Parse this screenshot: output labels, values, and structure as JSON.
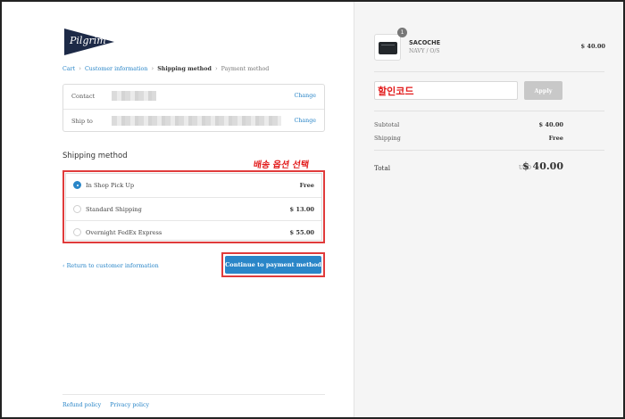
{
  "brand": {
    "logo_text": "Pilgrim",
    "logo_color": "#1d2a47"
  },
  "breadcrumb": {
    "cart": "Cart",
    "customer_information": "Customer information",
    "shipping_method": "Shipping method",
    "payment_method": "Payment method"
  },
  "review": {
    "contact_label": "Contact",
    "ship_to_label": "Ship to",
    "change_label": "Change"
  },
  "shipping": {
    "title": "Shipping method",
    "annotation": "배송 옵션 선택",
    "options": [
      {
        "label": "In Shop Pick Up",
        "price": "Free",
        "selected": true
      },
      {
        "label": "Standard Shipping",
        "price": "$ 13.00",
        "selected": false
      },
      {
        "label": "Overnight FedEx Express",
        "price": "$ 55.00",
        "selected": false
      }
    ]
  },
  "actions": {
    "return_label": "Return to customer information",
    "continue_label": "Continue to payment method"
  },
  "footer": {
    "refund": "Refund policy",
    "privacy": "Privacy policy"
  },
  "order": {
    "quantity": "1",
    "product_name": "SACOCHE",
    "variant": "NAVY / O/S",
    "product_price": "$ 40.00",
    "discount_annotation": "할인코드",
    "apply_label": "Apply",
    "subtotal_label": "Subtotal",
    "subtotal_value": "$ 40.00",
    "shipping_label": "Shipping",
    "shipping_value": "Free",
    "total_label": "Total",
    "currency": "USD",
    "total_value": "$ 40.00"
  },
  "colors": {
    "accent": "#2a86c8",
    "annotation": "#e21b1b",
    "sidebar_bg": "#f5f5f5"
  }
}
